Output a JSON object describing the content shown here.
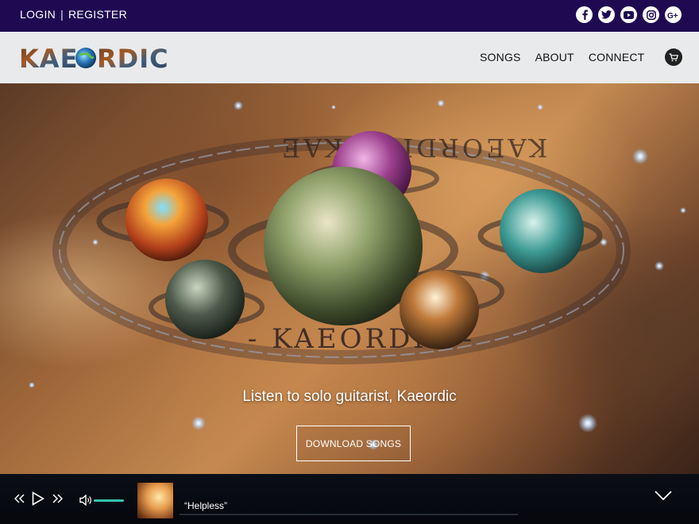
{
  "topbar": {
    "login_label": "LOGIN",
    "separator": "|",
    "register_label": "REGISTER",
    "social_icons": [
      "facebook-icon",
      "twitter-icon",
      "youtube-icon",
      "instagram-icon",
      "google-plus-icon"
    ]
  },
  "header": {
    "logo_text": "KAEORDIC",
    "nav": [
      "SONGS",
      "ABOUT",
      "CONNECT"
    ],
    "cart_icon": "cart-icon"
  },
  "hero": {
    "tagline": "Listen to solo guitarist, Kaeordic",
    "button_label": "DOWNLOAD SONGS",
    "art_text": "KAEORDIC - KAEORDIC - KAEORDIC -"
  },
  "player": {
    "song_title": "“Helpless”",
    "accent_color": "#37c3b2",
    "volume_level": 1.0
  },
  "colors": {
    "topbar_bg": "#1f0a52",
    "header_bg": "#e8eaec"
  }
}
